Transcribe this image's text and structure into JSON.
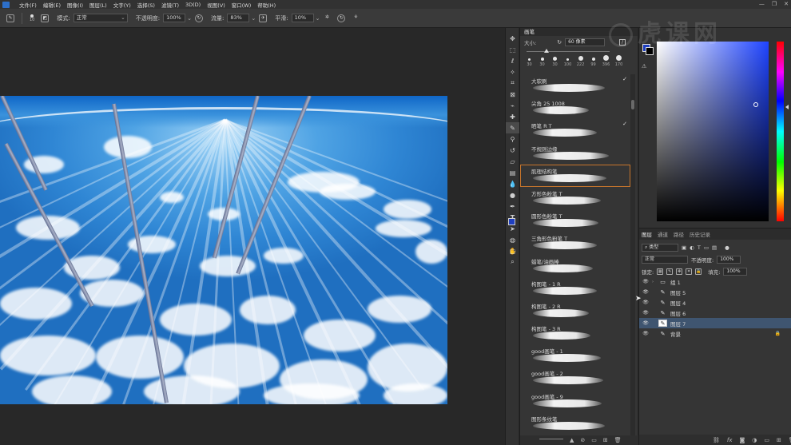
{
  "menubar": {
    "items": [
      "文件(F)",
      "编辑(E)",
      "图像(I)",
      "图层(L)",
      "文字(Y)",
      "选择(S)",
      "滤镜(T)",
      "3D(D)",
      "视图(V)",
      "窗口(W)",
      "帮助(H)"
    ],
    "window_buttons": [
      "—",
      "❐",
      "✕"
    ]
  },
  "optionsbar": {
    "brush_size": "10",
    "mode_label": "模式:",
    "mode_value": "正常",
    "opacity_label": "不透明度:",
    "opacity_value": "100%",
    "flow_label": "流量:",
    "flow_value": "83%",
    "smoothing_label": "平滑:",
    "smoothing_value": "10%"
  },
  "watermark": {
    "text": "虎课网"
  },
  "brush_panel": {
    "title": "画笔",
    "size_label": "大小:",
    "size_value": "60 像素",
    "presets": [
      {
        "num": "30",
        "d": 3
      },
      {
        "num": "30",
        "d": 4
      },
      {
        "num": "30",
        "d": 5
      },
      {
        "num": "100",
        "d": 3
      },
      {
        "num": "222",
        "d": 6
      },
      {
        "num": "99",
        "d": 4
      },
      {
        "num": "396",
        "d": 7
      },
      {
        "num": "170",
        "d": 7
      }
    ],
    "brushes": [
      {
        "name": "大软刷",
        "w": 90,
        "checked": true
      },
      {
        "name": "尖角 25 1008",
        "w": 70,
        "checked": false
      },
      {
        "name": "晒笔 R T",
        "w": 80,
        "checked": true
      },
      {
        "name": "不规则边缘",
        "w": 95,
        "checked": false
      },
      {
        "name": "肌理结构笔",
        "w": 92,
        "checked": false,
        "selected": true
      },
      {
        "name": "方形色粉笔 T",
        "w": 85,
        "checked": false
      },
      {
        "name": "圆形色粉笔 T",
        "w": 82,
        "checked": false
      },
      {
        "name": "三角形色粉笔 T",
        "w": 80,
        "checked": false
      },
      {
        "name": "蜡笔/油画棒",
        "w": 75,
        "checked": false
      },
      {
        "name": "构图笔 - 1 R",
        "w": 80,
        "checked": false
      },
      {
        "name": "构图笔 - 2 R",
        "w": 70,
        "checked": false
      },
      {
        "name": "构图笔 - 3 R",
        "w": 72,
        "checked": false
      },
      {
        "name": "good画笔 - 1",
        "w": 85,
        "checked": false
      },
      {
        "name": "good画笔 - 2",
        "w": 88,
        "checked": false
      },
      {
        "name": "good画笔 - 9",
        "w": 86,
        "checked": false
      },
      {
        "name": "图形条纹笔",
        "w": 90,
        "checked": false
      }
    ]
  },
  "layers_panel": {
    "tabs": [
      "图层",
      "通道",
      "路径",
      "历史记录"
    ],
    "filter_value": "类型",
    "blend_mode": "正常",
    "opacity_label": "不透明度:",
    "opacity_value": "100%",
    "lock_label": "锁定:",
    "fill_label": "填充:",
    "fill_value": "100%",
    "layers": [
      {
        "name": "组 1",
        "type": "group",
        "selected": false,
        "locked": false
      },
      {
        "name": "图层 5",
        "type": "layer",
        "selected": false,
        "locked": false
      },
      {
        "name": "图层 4",
        "type": "layer",
        "selected": false,
        "locked": false
      },
      {
        "name": "图层 6",
        "type": "layer",
        "selected": false,
        "locked": false
      },
      {
        "name": "图层 7",
        "type": "layer",
        "selected": true,
        "locked": false
      },
      {
        "name": "背景",
        "type": "layer",
        "selected": false,
        "locked": true
      }
    ]
  },
  "colors": {
    "foreground": "#1f3fbf",
    "background": "#000000",
    "selected_brush_outline": "#c8762c",
    "selected_layer_bg": "#3f5570"
  }
}
